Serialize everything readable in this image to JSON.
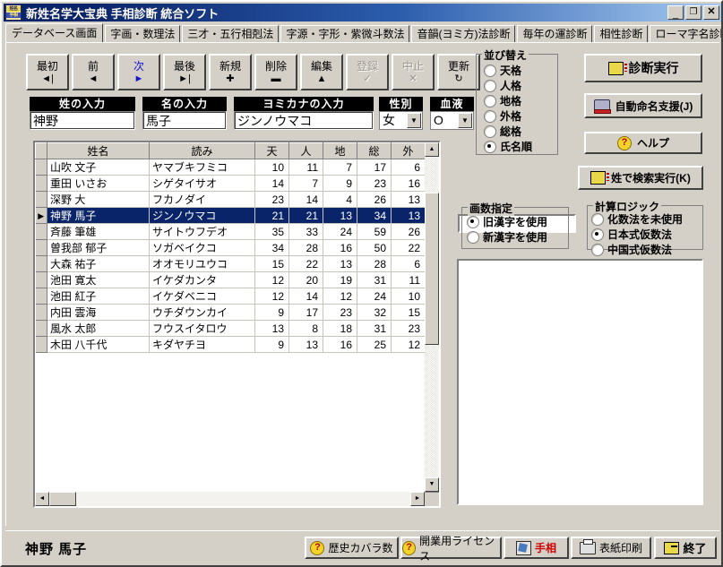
{
  "window": {
    "title": "新姓名学大宝典  手相診断  統合ソフト",
    "icon_top": "姓名",
    "icon_bottom": "手相",
    "minimize": "_",
    "maximize": "❐",
    "close": "✕"
  },
  "tabs": [
    {
      "label": "データベース画面",
      "active": true
    },
    {
      "label": "字画・数理法",
      "active": false
    },
    {
      "label": "三才・五行相剋法",
      "active": false
    },
    {
      "label": "字源・字形・紫微斗数法",
      "active": false
    },
    {
      "label": "音韻(ヨミ方)法診断",
      "active": false
    },
    {
      "label": "毎年の運診断",
      "active": false
    },
    {
      "label": "相性診断",
      "active": false
    },
    {
      "label": "ローマ字名診断",
      "active": false
    }
  ],
  "navbar": [
    {
      "label": "最初",
      "icon": "◄|",
      "state": "normal"
    },
    {
      "label": "前",
      "icon": "◄",
      "state": "normal"
    },
    {
      "label": "次",
      "icon": "►",
      "state": "accent"
    },
    {
      "label": "最後",
      "icon": "►|",
      "state": "normal"
    },
    {
      "label": "新規",
      "icon": "✚",
      "state": "normal"
    },
    {
      "label": "削除",
      "icon": "▬",
      "state": "normal"
    },
    {
      "label": "編集",
      "icon": "▲",
      "state": "normal"
    },
    {
      "label": "登録",
      "icon": "✓",
      "state": "disabled"
    },
    {
      "label": "中止",
      "icon": "✕",
      "state": "disabled"
    },
    {
      "label": "更新",
      "icon": "↻",
      "state": "normal"
    }
  ],
  "fields": {
    "surname": {
      "caption": "姓の入力",
      "value": "神野"
    },
    "givenname": {
      "caption": "名の入力",
      "value": "馬子"
    },
    "yomikana": {
      "caption": "ヨミカナの入力",
      "value": "ジンノウマコ"
    },
    "gender": {
      "caption": "性別",
      "value": "女"
    },
    "blood": {
      "caption": "血液",
      "value": "O"
    }
  },
  "grid": {
    "headers": [
      "姓名",
      "読み",
      "天",
      "人",
      "地",
      "総",
      "外"
    ],
    "rows": [
      {
        "name": "山吹 文子",
        "yomi": "ヤマブキフミコ",
        "ten": "10",
        "jin": "11",
        "chi": "7",
        "sou": "17",
        "gai": "6",
        "selected": false
      },
      {
        "name": "重田 いさお",
        "yomi": "シゲタイサオ",
        "ten": "14",
        "jin": "7",
        "chi": "9",
        "sou": "23",
        "gai": "16",
        "selected": false
      },
      {
        "name": "深野 大",
        "yomi": "フカノダイ",
        "ten": "23",
        "jin": "14",
        "chi": "4",
        "sou": "26",
        "gai": "13",
        "selected": false
      },
      {
        "name": "神野 馬子",
        "yomi": "ジンノウマコ",
        "ten": "21",
        "jin": "21",
        "chi": "13",
        "sou": "34",
        "gai": "13",
        "selected": true
      },
      {
        "name": "斉藤 筆雄",
        "yomi": "サイトウフデオ",
        "ten": "35",
        "jin": "33",
        "chi": "24",
        "sou": "59",
        "gai": "26",
        "selected": false
      },
      {
        "name": "曽我部 郁子",
        "yomi": "ソガベイクコ",
        "ten": "34",
        "jin": "28",
        "chi": "16",
        "sou": "50",
        "gai": "22",
        "selected": false
      },
      {
        "name": "大森 祐子",
        "yomi": "オオモリユウコ",
        "ten": "15",
        "jin": "22",
        "chi": "13",
        "sou": "28",
        "gai": "6",
        "selected": false
      },
      {
        "name": "池田 寛太",
        "yomi": "イケダカンタ",
        "ten": "12",
        "jin": "20",
        "chi": "19",
        "sou": "31",
        "gai": "11",
        "selected": false
      },
      {
        "name": "池田 紅子",
        "yomi": "イケダベニコ",
        "ten": "12",
        "jin": "14",
        "chi": "12",
        "sou": "24",
        "gai": "10",
        "selected": false
      },
      {
        "name": "内田 雲海",
        "yomi": "ウチダウンカイ",
        "ten": "9",
        "jin": "17",
        "chi": "23",
        "sou": "32",
        "gai": "15",
        "selected": false
      },
      {
        "name": "風水 太郎",
        "yomi": "フウスイタロウ",
        "ten": "13",
        "jin": "8",
        "chi": "18",
        "sou": "31",
        "gai": "23",
        "selected": false
      },
      {
        "name": "木田 八千代",
        "yomi": "キダヤチヨ",
        "ten": "9",
        "jin": "13",
        "chi": "16",
        "sou": "25",
        "gai": "12",
        "selected": false
      }
    ]
  },
  "sort_group": {
    "title": "並び替え",
    "options": [
      {
        "label": "天格",
        "checked": false
      },
      {
        "label": "人格",
        "checked": false
      },
      {
        "label": "地格",
        "checked": false
      },
      {
        "label": "外格",
        "checked": false
      },
      {
        "label": "総格",
        "checked": false
      },
      {
        "label": "氏名順",
        "checked": true
      }
    ]
  },
  "kakusu_group": {
    "title": "画数指定",
    "options": [
      {
        "label": "旧漢字を使用",
        "checked": true
      },
      {
        "label": "新漢字を使用",
        "checked": false
      }
    ]
  },
  "logic_group": {
    "title": "計算ロジック",
    "options": [
      {
        "label": "化数法を未使用",
        "checked": false
      },
      {
        "label": "日本式仮数法",
        "checked": true
      },
      {
        "label": "中国式仮数法",
        "checked": false
      }
    ]
  },
  "action_buttons": {
    "diagnose": "診断実行",
    "auto_naming": "自動命名支援(J)",
    "help": "ヘルプ",
    "search_by_surname": "姓で検索実行(K)"
  },
  "search_input": {
    "value": "",
    "placeholder": ""
  },
  "status": {
    "current_name": "神野  馬子",
    "buttons": [
      {
        "label": "歴史カバラ数",
        "icon": "question-icon"
      },
      {
        "label": "開業用ライセンス",
        "icon": "question-icon"
      },
      {
        "label": "手相",
        "icon": "palm-icon"
      },
      {
        "label": "表紙印刷",
        "icon": "printer-icon"
      },
      {
        "label": "終了",
        "icon": "exit-icon"
      }
    ]
  },
  "colors": {
    "titlebar_start": "#0a246a",
    "titlebar_end": "#a6caf0",
    "face": "#d4d0c8",
    "selection": "#0a246a",
    "accent_text": "#1515cc",
    "red_text": "#d00000"
  }
}
